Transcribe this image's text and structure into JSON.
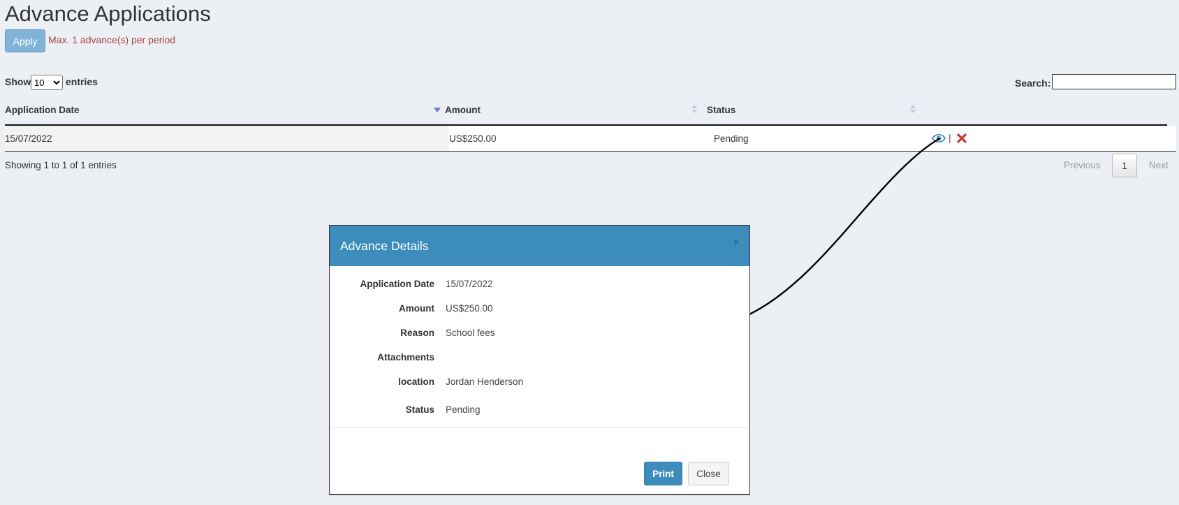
{
  "page": {
    "title": "Advance Applications",
    "apply_label": "Apply",
    "limit_note": "Max. 1 advance(s) per period"
  },
  "table_controls": {
    "show_label": "Show",
    "length_value": "10",
    "length_options": [
      "10"
    ],
    "entries_label": "entries",
    "search_label": "Search:",
    "search_value": ""
  },
  "table": {
    "columns": [
      "Application Date",
      "Amount",
      "Status",
      ""
    ],
    "rows": [
      {
        "date": "15/07/2022",
        "amount": "US$250.00",
        "status": "Pending",
        "separator": "|"
      }
    ]
  },
  "pagination": {
    "info": "Showing 1 to 1 of 1 entries",
    "previous": "Previous",
    "current": "1",
    "next": "Next"
  },
  "modal": {
    "title": "Advance Details",
    "close_glyph": "×",
    "fields": [
      {
        "label": "Application Date",
        "value": "15/07/2022"
      },
      {
        "label": "Amount",
        "value": "US$250.00"
      },
      {
        "label": "Reason",
        "value": "School fees"
      },
      {
        "label": "Attachments",
        "value": ""
      },
      {
        "label": "location",
        "value": "Jordan Henderson"
      },
      {
        "label": "Status",
        "value": "Pending"
      }
    ],
    "print_label": "Print",
    "close_label": "Close"
  },
  "colors": {
    "background": "#eceff4",
    "primary": "#3c8dbc",
    "apply_button": "#7fb3d8",
    "danger": "#c0392b",
    "warning_text": "#a94442"
  }
}
